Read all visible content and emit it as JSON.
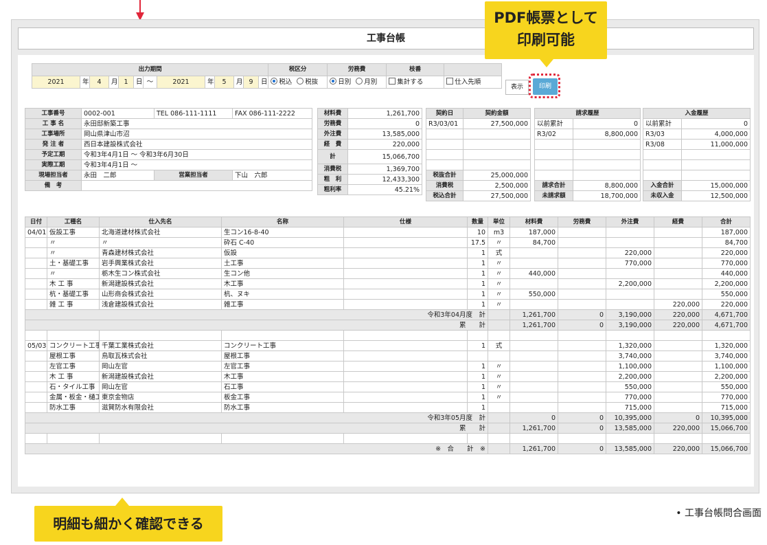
{
  "callouts": {
    "pdf_line1": "PDF帳票として",
    "pdf_line2": "印刷可能",
    "detail": "明細も細かく確認できる",
    "caption": "• 工事台帳問合画面"
  },
  "title": "工事台帳",
  "filter": {
    "headers": {
      "period": "出力期間",
      "tax": "税区分",
      "labor": "労務費",
      "branch": "枝番"
    },
    "from": {
      "year": "2021",
      "year_unit": "年",
      "month": "4",
      "month_unit": "月",
      "day": "1",
      "day_unit": "日"
    },
    "tilde": "〜",
    "to": {
      "year": "2021",
      "year_unit": "年",
      "month": "5",
      "month_unit": "月",
      "day": "9",
      "day_unit": "日"
    },
    "tax_in": "税込",
    "tax_out": "税抜",
    "labor_daily": "日別",
    "labor_monthly": "月別",
    "aggregate": "集計する",
    "supplier_order": "仕入先順",
    "show_button": "表示",
    "print_button": "印刷"
  },
  "info": [
    {
      "label": "工事番号",
      "value": "0002-001",
      "extra1": "TEL 086-111-1111",
      "extra2": "FAX 086-111-2222"
    },
    {
      "label": "工 事 名",
      "value": "永田邸新築工事"
    },
    {
      "label": "工事場所",
      "value": "岡山県津山市沼"
    },
    {
      "label": "発 注 者",
      "value": "西日本建設株式会社"
    },
    {
      "label": "予定工期",
      "value": "令和3年4月1日 〜 令和3年6月30日"
    },
    {
      "label": "実際工期",
      "value": "令和3年4月1日 〜"
    },
    {
      "label": "現場担当者",
      "value": "永田　二郎",
      "label2": "営業担当者",
      "value2": "下山　六郎"
    },
    {
      "label": "備　考",
      "value": ""
    }
  ],
  "costs": [
    {
      "label": "材料費",
      "value": "1,261,700"
    },
    {
      "label": "労務費",
      "value": "0"
    },
    {
      "label": "外注費",
      "value": "13,585,000"
    },
    {
      "label": "経　費",
      "value": "220,000"
    },
    {
      "label": "計",
      "value": "15,066,700"
    },
    {
      "label": "消費税",
      "value": "1,369,700"
    },
    {
      "label": "粗　利",
      "value": "12,433,300"
    },
    {
      "label": "粗利率",
      "value": "45.21%"
    }
  ],
  "contract": {
    "h_date": "契約日",
    "h_amount": "契約金額",
    "date": "R3/03/01",
    "amount": "27,500,000",
    "pre_label": "税抜合計",
    "pre": "25,000,000",
    "tax_label": "消費税",
    "tax": "2,500,000",
    "total_label": "税込合計",
    "total": "27,500,000"
  },
  "billing": {
    "header": "請求履歴",
    "rows": [
      [
        "以前累計",
        "0"
      ],
      [
        "R3/02",
        "8,800,000"
      ]
    ],
    "sum_label": "請求合計",
    "sum": "8,800,000",
    "unbilled_label": "未請求額",
    "unbilled": "18,700,000"
  },
  "deposit": {
    "header": "入金履歴",
    "rows": [
      [
        "以前累計",
        "0"
      ],
      [
        "R3/03",
        "4,000,000"
      ],
      [
        "R3/08",
        "11,000,000"
      ]
    ],
    "sum_label": "入金合計",
    "sum": "15,000,000",
    "unpaid_label": "未収入金",
    "unpaid": "12,500,000"
  },
  "detail_headers": [
    "日付",
    "工種名",
    "仕入先名",
    "名称",
    "仕様",
    "数量",
    "単位",
    "材料費",
    "労務費",
    "外注費",
    "経費",
    "合計"
  ],
  "detail_rows": [
    {
      "t": "row",
      "c": [
        "04/01",
        "仮設工事",
        "北海道建材株式会社",
        "生コン16-8-40",
        "",
        "10",
        "m3",
        "187,000",
        "",
        "",
        "",
        "187,000"
      ]
    },
    {
      "t": "row",
      "c": [
        "",
        "〃",
        "〃",
        "砕石 C-40",
        "",
        "17.5",
        "〃",
        "84,700",
        "",
        "",
        "",
        "84,700"
      ]
    },
    {
      "t": "row",
      "c": [
        "",
        "〃",
        "青森建材株式会社",
        "仮設",
        "",
        "1",
        "式",
        "",
        "",
        "220,000",
        "",
        "220,000"
      ]
    },
    {
      "t": "row",
      "c": [
        "",
        "土・基礎工事",
        "岩手興業株式会社",
        "土工事",
        "",
        "1",
        "〃",
        "",
        "",
        "770,000",
        "",
        "770,000"
      ]
    },
    {
      "t": "row",
      "c": [
        "",
        "〃",
        "栃木生コン株式会社",
        "生コン他",
        "",
        "1",
        "〃",
        "440,000",
        "",
        "",
        "",
        "440,000"
      ]
    },
    {
      "t": "row",
      "c": [
        "",
        "木 工 事",
        "新潟建設株式会社",
        "木工事",
        "",
        "1",
        "〃",
        "",
        "",
        "2,200,000",
        "",
        "2,200,000"
      ]
    },
    {
      "t": "row",
      "c": [
        "",
        "杭・基礎工事",
        "山形商会株式会社",
        "杭、ヌキ",
        "",
        "1",
        "〃",
        "550,000",
        "",
        "",
        "",
        "550,000"
      ]
    },
    {
      "t": "row",
      "c": [
        "",
        "雑 工 事",
        "浅倉建設株式会社",
        "雑工事",
        "",
        "1",
        "〃",
        "",
        "",
        "",
        "220,000",
        "220,000"
      ]
    },
    {
      "t": "sum",
      "label": "令和3年04月度　計",
      "c": [
        "1,261,700",
        "0",
        "3,190,000",
        "220,000",
        "4,671,700"
      ]
    },
    {
      "t": "sum",
      "label": "累　　計",
      "c": [
        "1,261,700",
        "0",
        "3,190,000",
        "220,000",
        "4,671,700"
      ]
    },
    {
      "t": "row",
      "c": [
        "",
        "",
        "",
        "",
        "",
        "",
        "",
        "",
        "",
        "",
        "",
        ""
      ]
    },
    {
      "t": "row",
      "c": [
        "05/03",
        "コンクリート工事",
        "千葉工業株式会社",
        "コンクリート工事",
        "",
        "1",
        "式",
        "",
        "",
        "1,320,000",
        "",
        "1,320,000"
      ]
    },
    {
      "t": "row",
      "c": [
        "",
        "屋根工事",
        "鳥取瓦株式会社",
        "屋根工事",
        "",
        "",
        "",
        "",
        "",
        "3,740,000",
        "",
        "3,740,000"
      ]
    },
    {
      "t": "row",
      "c": [
        "",
        "左官工事",
        "岡山左官",
        "左官工事",
        "",
        "1",
        "〃",
        "",
        "",
        "1,100,000",
        "",
        "1,100,000"
      ]
    },
    {
      "t": "row",
      "c": [
        "",
        "木 工 事",
        "新潟建設株式会社",
        "木工事",
        "",
        "1",
        "〃",
        "",
        "",
        "2,200,000",
        "",
        "2,200,000"
      ]
    },
    {
      "t": "row",
      "c": [
        "",
        "石・タイル工事",
        "岡山左官",
        "石工事",
        "",
        "1",
        "〃",
        "",
        "",
        "550,000",
        "",
        "550,000"
      ]
    },
    {
      "t": "row",
      "c": [
        "",
        "金属・板金・樋工事",
        "東京金物店",
        "板金工事",
        "",
        "1",
        "〃",
        "",
        "",
        "770,000",
        "",
        "770,000"
      ]
    },
    {
      "t": "row",
      "c": [
        "",
        "防水工事",
        "滋賀防水有限会社",
        "防水工事",
        "",
        "1",
        "",
        "",
        "",
        "715,000",
        "",
        "715,000"
      ]
    },
    {
      "t": "sum",
      "label": "令和3年05月度　計",
      "c": [
        "0",
        "0",
        "10,395,000",
        "0",
        "10,395,000"
      ]
    },
    {
      "t": "sum",
      "label": "累　　計",
      "c": [
        "1,261,700",
        "0",
        "13,585,000",
        "220,000",
        "15,066,700"
      ]
    },
    {
      "t": "row",
      "c": [
        "",
        "",
        "",
        "",
        "",
        "",
        "",
        "",
        "",
        "",
        "",
        ""
      ]
    },
    {
      "t": "sum",
      "label": "※　合　　計　※",
      "c": [
        "1,261,700",
        "0",
        "13,585,000",
        "220,000",
        "15,066,700"
      ]
    }
  ]
}
